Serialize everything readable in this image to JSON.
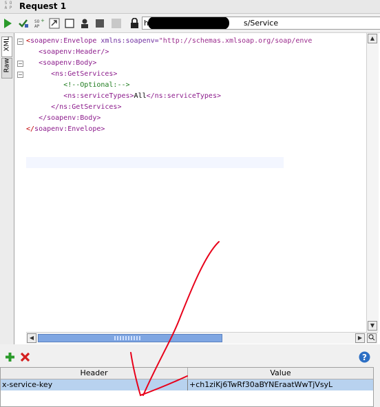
{
  "app": {
    "tab_title": "Request 1",
    "soap_icon_label": "SOAP"
  },
  "toolbar": {
    "icons": [
      "play-icon",
      "check-add-icon",
      "soap-add-icon",
      "format-icon",
      "checkbox-icon",
      "user-icon",
      "stop-icon",
      "lock-icon"
    ],
    "url_suffix": "s/Service",
    "url_prefix": "h"
  },
  "sidetabs": {
    "xml_label": "XML",
    "raw_label": "Raw"
  },
  "editor": {
    "lines": [
      {
        "indent": "",
        "parts": [
          [
            "tagred",
            "<"
          ],
          [
            "tag",
            "soapenv:Envelope "
          ],
          [
            "attr",
            "xmlns:soapenv="
          ],
          [
            "str",
            "\"http://schemas.xmlsoap.org/soap/enve"
          ]
        ]
      },
      {
        "indent": "   ",
        "parts": [
          [
            "tag",
            "<soapenv:Header/>"
          ]
        ]
      },
      {
        "indent": "   ",
        "parts": [
          [
            "tag",
            "<soapenv:Body>"
          ]
        ]
      },
      {
        "indent": "      ",
        "parts": [
          [
            "tag",
            "<ns:GetServices>"
          ]
        ]
      },
      {
        "indent": "         ",
        "parts": [
          [
            "cmt",
            "<!--Optional:-->"
          ]
        ]
      },
      {
        "indent": "         ",
        "parts": [
          [
            "tag",
            "<ns:serviceTypes>"
          ],
          [
            "",
            "All"
          ],
          [
            "tag",
            "</ns:serviceTypes>"
          ]
        ]
      },
      {
        "indent": "      ",
        "parts": [
          [
            "tag",
            "</ns:GetServices>"
          ]
        ]
      },
      {
        "indent": "   ",
        "parts": [
          [
            "tag",
            "</soapenv:Body>"
          ]
        ]
      },
      {
        "indent": "",
        "parts": [
          [
            "tagred",
            "</"
          ],
          [
            "tag",
            "soapenv:Envelope>"
          ]
        ]
      }
    ]
  },
  "headers_panel": {
    "add_icon": "plus-icon",
    "remove_icon": "delete-icon",
    "help_icon": "help-icon",
    "columns": [
      "Header",
      "Value"
    ],
    "rows": [
      {
        "header": "x-service-key",
        "value": "+ch1ziKj6TwRf30aBYNEraatWwTjVsyL"
      }
    ]
  },
  "colors": {
    "selected_row": "#b8d2ef",
    "scroll_thumb": "#7fa6e2",
    "annotation": "#e8001a"
  }
}
